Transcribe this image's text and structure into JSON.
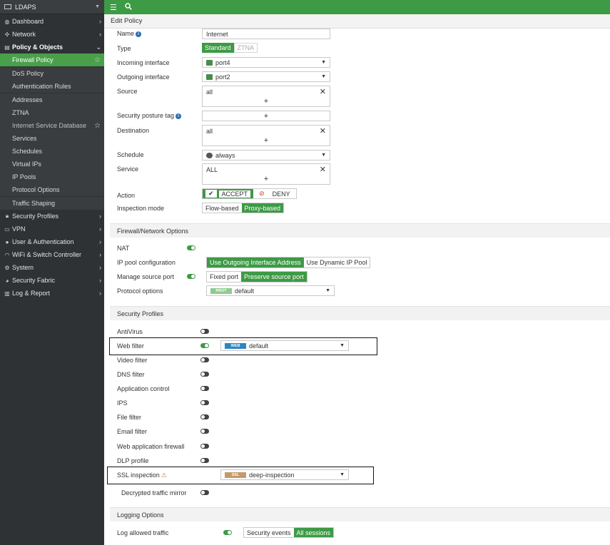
{
  "device": {
    "name": "LDAPS"
  },
  "sidebar": {
    "top": [
      {
        "label": "Dashboard",
        "icon": "dashboard-icon"
      },
      {
        "label": "Network",
        "icon": "network-icon"
      },
      {
        "label": "Policy & Objects",
        "icon": "policy-icon"
      }
    ],
    "sub": [
      {
        "label": "Firewall Policy",
        "active": true
      },
      {
        "label": "DoS Policy"
      },
      {
        "label": "Authentication Rules"
      },
      {
        "label": "Addresses"
      },
      {
        "label": "ZTNA"
      },
      {
        "label": "Internet Service Database"
      },
      {
        "label": "Services"
      },
      {
        "label": "Schedules"
      },
      {
        "label": "Virtual IPs"
      },
      {
        "label": "IP Pools"
      },
      {
        "label": "Protocol Options"
      },
      {
        "label": "Traffic Shaping"
      }
    ],
    "bottom": [
      {
        "label": "Security Profiles",
        "icon": "lock-icon"
      },
      {
        "label": "VPN",
        "icon": "monitor-icon"
      },
      {
        "label": "User & Authentication",
        "icon": "user-icon"
      },
      {
        "label": "WiFi & Switch Controller",
        "icon": "wifi-icon"
      },
      {
        "label": "System",
        "icon": "gear-icon"
      },
      {
        "label": "Security Fabric",
        "icon": "fabric-icon"
      },
      {
        "label": "Log & Report",
        "icon": "chart-icon"
      }
    ]
  },
  "page": {
    "title": "Edit Policy"
  },
  "form": {
    "name": {
      "label": "Name",
      "value": "Internet"
    },
    "type": {
      "label": "Type",
      "options": [
        "Standard",
        "ZTNA"
      ],
      "selected": "Standard"
    },
    "incoming": {
      "label": "Incoming interface",
      "value": "port4"
    },
    "outgoing": {
      "label": "Outgoing interface",
      "value": "port2"
    },
    "source": {
      "label": "Source",
      "value": "all"
    },
    "posture": {
      "label": "Security posture tag"
    },
    "destination": {
      "label": "Destination",
      "value": "all"
    },
    "schedule": {
      "label": "Schedule",
      "value": "always"
    },
    "service": {
      "label": "Service",
      "value": "ALL"
    },
    "action": {
      "label": "Action",
      "accept": "ACCEPT",
      "deny": "DENY",
      "selected": "ACCEPT"
    },
    "inspection": {
      "label": "Inspection mode",
      "options": [
        "Flow-based",
        "Proxy-based"
      ],
      "selected": "Proxy-based"
    }
  },
  "fw_section": {
    "title": "Firewall/Network Options",
    "nat": {
      "label": "NAT",
      "on": true
    },
    "ippool": {
      "label": "IP pool configuration",
      "options": [
        "Use Outgoing Interface Address",
        "Use Dynamic IP Pool"
      ],
      "selected": "Use Outgoing Interface Address"
    },
    "msp": {
      "label": "Manage source port",
      "on": true,
      "options": [
        "Fixed port",
        "Preserve source port"
      ],
      "selected": "Preserve source port"
    },
    "proto": {
      "label": "Protocol options",
      "tag": "PROT",
      "value": "default",
      "tag_color": "#8fc98f"
    }
  },
  "sp_section": {
    "title": "Security Profiles",
    "antivirus": {
      "label": "AntiVirus",
      "on": false
    },
    "webfilter": {
      "label": "Web filter",
      "on": true,
      "tag": "WEB",
      "value": "default",
      "tag_color": "#2e86c1"
    },
    "video": {
      "label": "Video filter",
      "on": false
    },
    "dns": {
      "label": "DNS filter",
      "on": false
    },
    "app": {
      "label": "Application control",
      "on": false
    },
    "ips": {
      "label": "IPS",
      "on": false
    },
    "file": {
      "label": "File filter",
      "on": false
    },
    "email": {
      "label": "Email filter",
      "on": false
    },
    "waf": {
      "label": "Web application firewall",
      "on": false
    },
    "dlp": {
      "label": "DLP profile",
      "on": false
    },
    "ssl": {
      "label": "SSL inspection",
      "tag": "SSL",
      "value": "deep-inspection",
      "tag_color": "#c39a6b"
    },
    "mirror": {
      "label": "Decrypted traffic mirror",
      "on": false
    }
  },
  "log_section": {
    "title": "Logging Options",
    "allowed": {
      "label": "Log allowed traffic",
      "on": true,
      "options": [
        "Security events",
        "All sessions"
      ],
      "selected": "All sessions"
    }
  },
  "colors": {
    "accent": "#3d9a45",
    "sidebar": "#2f3234"
  }
}
